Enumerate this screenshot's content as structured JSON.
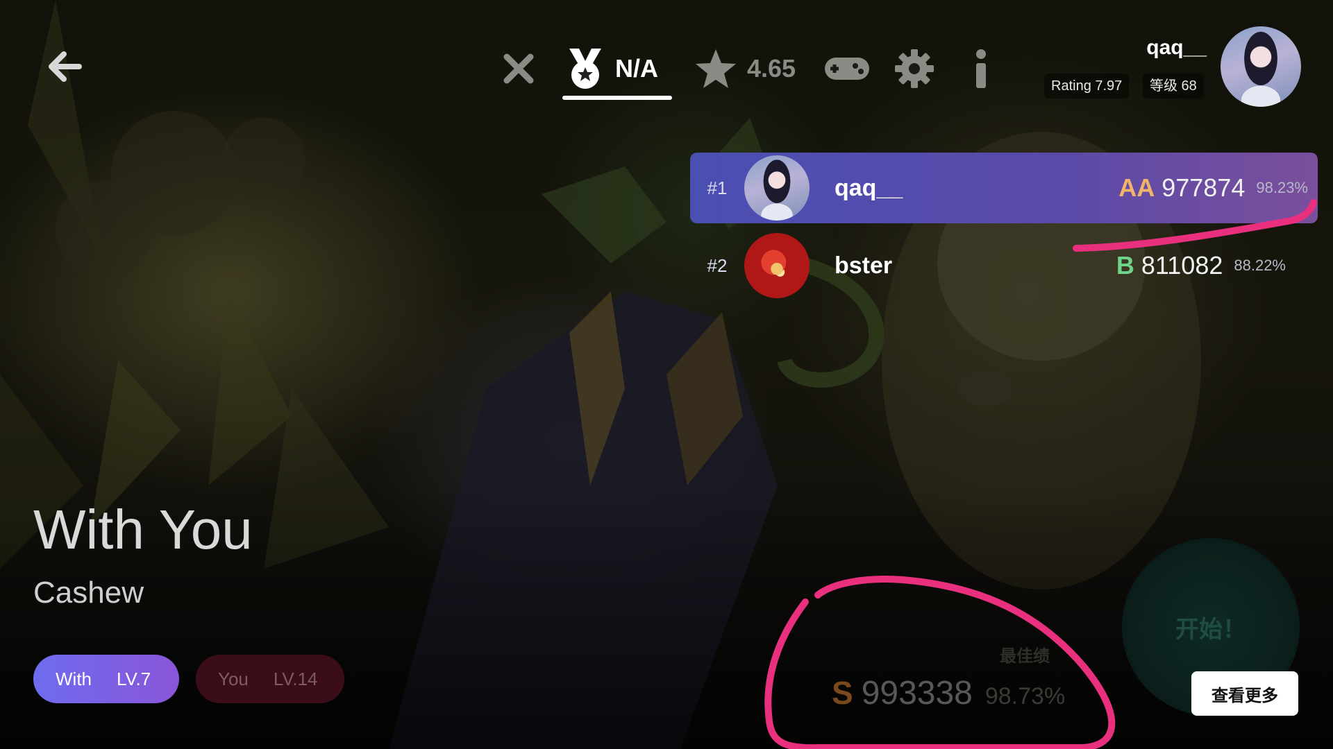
{
  "header": {
    "back_icon": "arrow-left-icon",
    "nav": [
      {
        "id": "close",
        "icon": "close-icon",
        "label": ""
      },
      {
        "id": "medal",
        "icon": "medal-icon",
        "label": "N/A"
      },
      {
        "id": "rating",
        "icon": "star-icon",
        "label": "4.65"
      },
      {
        "id": "gamepad",
        "icon": "gamepad-icon",
        "label": ""
      },
      {
        "id": "settings",
        "icon": "gear-icon",
        "label": ""
      },
      {
        "id": "info",
        "icon": "info-icon",
        "label": ""
      }
    ]
  },
  "profile": {
    "name": "qaq__",
    "rating": "Rating 7.97",
    "level": "等级 68"
  },
  "leaderboard": [
    {
      "rank": "#1",
      "name": "qaq__",
      "grade": "AA",
      "grade_color": "#f0b56a",
      "score": "977874",
      "accuracy": "98.23%"
    },
    {
      "rank": "#2",
      "name": "bster",
      "grade": "B",
      "grade_color": "#6fd38a",
      "score": "811082",
      "accuracy": "88.22%"
    }
  ],
  "song": {
    "title": "With You",
    "artist": "Cashew",
    "difficulties": [
      {
        "name": "With",
        "level": "LV.7"
      },
      {
        "name": "You",
        "level": "LV.14"
      }
    ]
  },
  "best": {
    "label": "最佳绩",
    "grade": "S",
    "score": "993338",
    "accuracy": "98.73%"
  },
  "actions": {
    "start": "开始！",
    "more": "查看更多"
  },
  "colors": {
    "annotation": "#e8307f",
    "selected_row": "#4a4fb2"
  }
}
